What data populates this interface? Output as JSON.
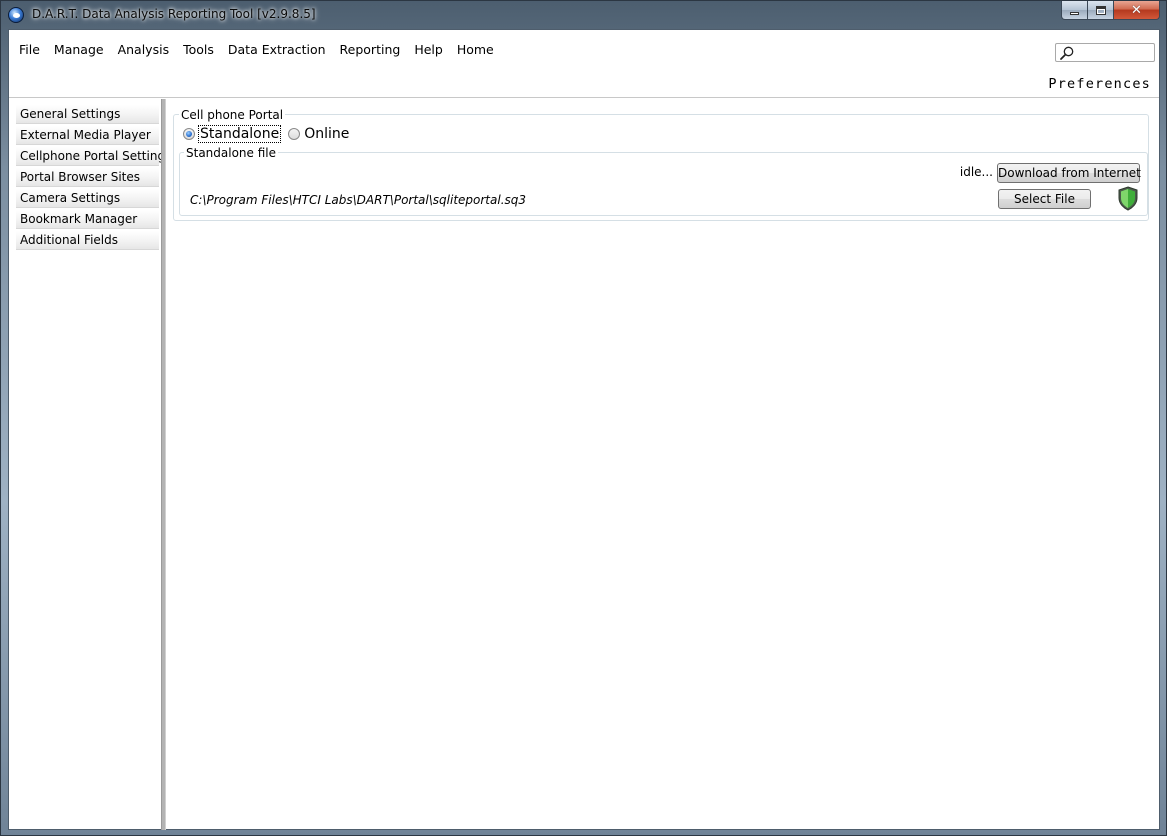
{
  "window": {
    "title": "D.A.R.T. Data Analysis Reporting Tool [v2.9.8.5]",
    "close_glyph": "✕"
  },
  "menu": {
    "items": [
      "File",
      "Manage",
      "Analysis",
      "Tools",
      "Data Extraction",
      "Reporting",
      "Help",
      "Home"
    ],
    "search_value": "",
    "page_label": "Preferences"
  },
  "sidebar": {
    "items": [
      "General Settings",
      "External Media Player",
      "Cellphone Portal Settings",
      "Portal Browser Sites",
      "Camera Settings",
      "Bookmark Manager",
      "Additional Fields"
    ]
  },
  "portal": {
    "group_label": "Cell phone Portal",
    "options": [
      {
        "label": "Standalone",
        "checked": true
      },
      {
        "label": "Online",
        "checked": false
      }
    ],
    "standalone": {
      "group_label": "Standalone file",
      "status": "idle...",
      "download_button": "Download from Internet",
      "select_button": "Select File",
      "file_path": "C:\\Program Files\\HTCI Labs\\DART\\Portal\\sqliteportal.sq3",
      "status_icon": "shield-icon",
      "status_color": "#3fae3a"
    }
  }
}
